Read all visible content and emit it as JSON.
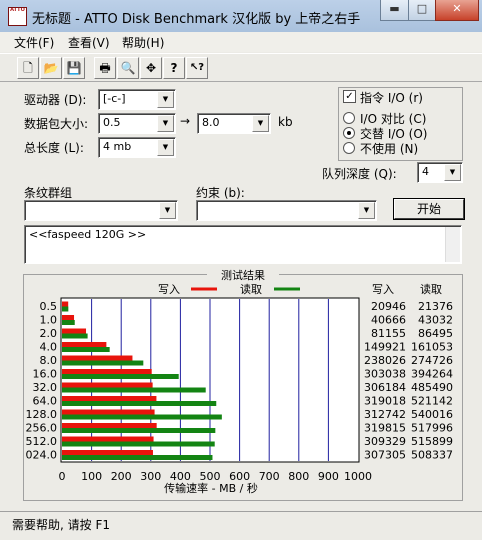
{
  "window": {
    "title": "无标题 - ATTO Disk Benchmark 汉化版 by 上帝之右手",
    "icon_text": "ATTO",
    "minimize_glyph": "▬",
    "maximize_glyph": "□",
    "close_glyph": "✕"
  },
  "menu": {
    "items": [
      "文件(F)",
      "查看(V)",
      "帮助(H)"
    ]
  },
  "toolbar": {
    "buttons": [
      {
        "icon": "new-file-icon",
        "glyph": "🗋"
      },
      {
        "icon": "open-folder-icon",
        "glyph": "📂"
      },
      {
        "icon": "save-disk-icon",
        "glyph": "💾"
      },
      {
        "icon": "print-icon",
        "glyph": "🖶"
      },
      {
        "icon": "print-preview-icon",
        "glyph": "🔍"
      },
      {
        "icon": "move-cross-icon",
        "glyph": "✥"
      },
      {
        "icon": "question-mark-icon",
        "glyph": "?"
      },
      {
        "icon": "context-help-icon",
        "glyph": "↖?"
      }
    ]
  },
  "settings": {
    "drive_label": "驱动器 (D):",
    "drive_value": "[-c-]",
    "transfer_label": "数据包大小:",
    "transfer_from": "0.5",
    "arrow": "→",
    "transfer_to": "8.0",
    "transfer_unit": "kb",
    "length_label": "总长度 (L):",
    "length_value": "4 mb",
    "io_direct_label": "指令 I/O (r)",
    "io_direct_checked": true,
    "radio_items": [
      "I/O 对比 (C)",
      "交替 I/O (O)",
      "不使用 (N)"
    ],
    "radio_selected": 1,
    "queue_label": "队列深度 (Q):",
    "queue_value": "4",
    "stripe_label": "条纹群组",
    "stripe_value": "",
    "constraint_label": "约束 (b):",
    "constraint_value": "",
    "start_button": "开始",
    "dropdown_glyph": "▼",
    "description": "<<faspeed 120G >>"
  },
  "results": {
    "title": "测试结果",
    "write_legend": "写入",
    "read_legend": "读取",
    "write_col": "写入",
    "read_col": "读取",
    "write_color": "#e8140c",
    "read_color": "#138413",
    "status": "需要帮助, 请按 F1"
  },
  "chart_data": {
    "type": "bar",
    "orientation": "horizontal",
    "categories": [
      "0.5",
      "1.0",
      "2.0",
      "4.0",
      "8.0",
      "16.0",
      "32.0",
      "64.0",
      "128.0",
      "256.0",
      "512.0",
      "024.0"
    ],
    "series": [
      {
        "name": "写入",
        "values": [
          20946,
          40666,
          81155,
          149921,
          238026,
          303038,
          306184,
          319018,
          312742,
          319815,
          309329,
          307305
        ]
      },
      {
        "name": "读取",
        "values": [
          21376,
          43032,
          86495,
          161053,
          274726,
          394264,
          485490,
          521142,
          540016,
          517996,
          515899,
          508337
        ]
      }
    ],
    "xlabel": "传输速率 - MB / 秒",
    "xticks": [
      0,
      100,
      200,
      300,
      400,
      500,
      600,
      700,
      800,
      900,
      1000
    ],
    "xlim": [
      0,
      1000
    ],
    "grid": true,
    "legend": "top"
  }
}
